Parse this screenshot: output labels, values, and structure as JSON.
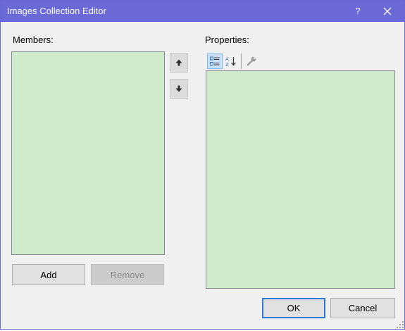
{
  "window": {
    "title": "Images Collection Editor",
    "help_label": "?",
    "accent_color": "#6b68d8"
  },
  "members": {
    "label": "Members:",
    "items": [],
    "move_up_icon": "arrow-up-icon",
    "move_down_icon": "arrow-down-icon",
    "add_label": "Add",
    "remove_label": "Remove",
    "remove_enabled": false
  },
  "properties": {
    "label": "Properties:",
    "toolbar": {
      "categorized_icon": "categorized-icon",
      "categorized_active": true,
      "alphabetical_icon": "alphabetical-sort-icon",
      "property_pages_icon": "wrench-icon"
    },
    "grid_color": "#cfeaca"
  },
  "footer": {
    "ok_label": "OK",
    "cancel_label": "Cancel"
  }
}
